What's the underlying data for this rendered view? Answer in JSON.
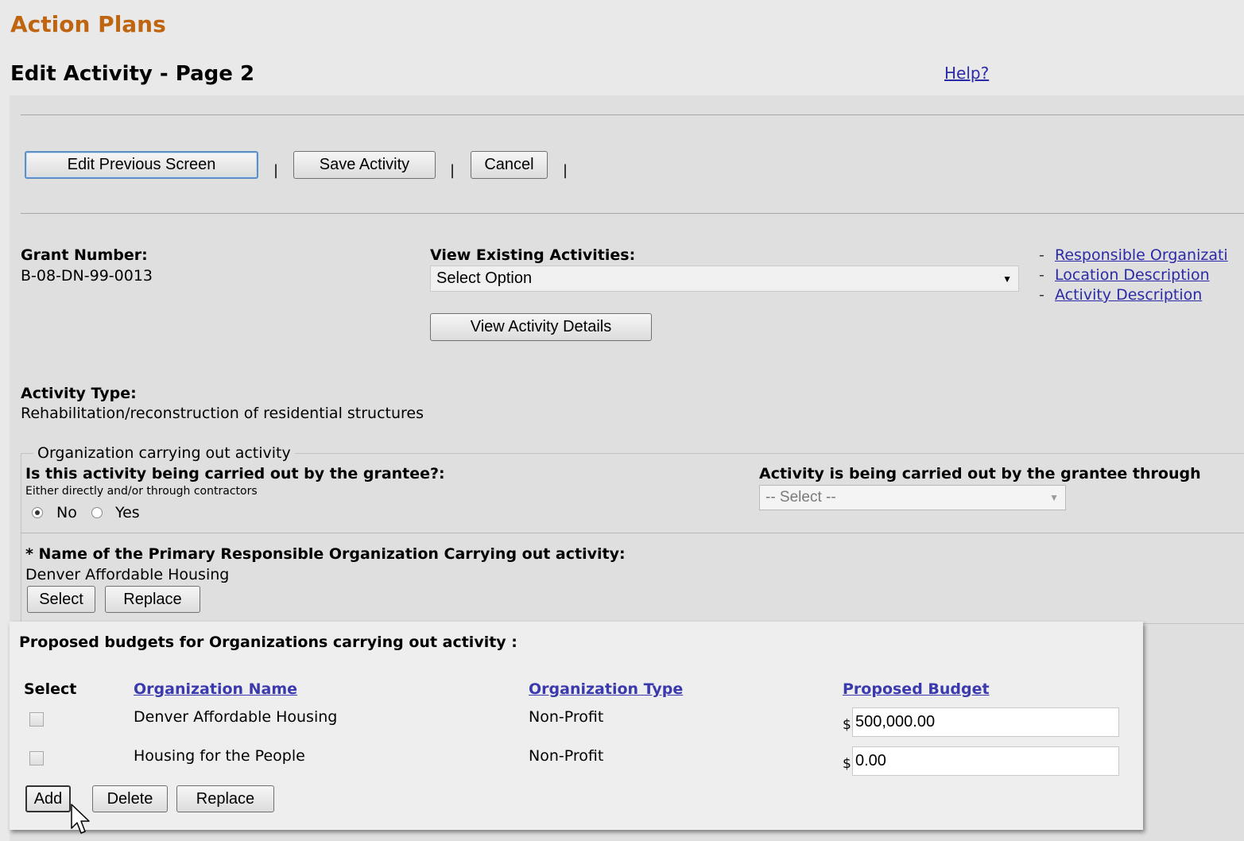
{
  "app_title": "Action Plans",
  "page_title": "Edit Activity - Page 2",
  "help_link": "Help?",
  "toolbar": {
    "edit_previous_label": "Edit Previous Screen",
    "save_label": "Save Activity",
    "cancel_label": "Cancel",
    "separator": "|"
  },
  "grant": {
    "label": "Grant Number:",
    "value": "B-08-DN-99-0013"
  },
  "view_existing": {
    "label": "View Existing Activities:",
    "selected": "Select Option",
    "details_button": "View Activity Details"
  },
  "quick_links": [
    {
      "dash": "-",
      "label": "Responsible Organizati"
    },
    {
      "dash": "-",
      "label": "Location Description"
    },
    {
      "dash": "-",
      "label": "Activity Description"
    }
  ],
  "activity_type": {
    "label": "Activity Type:",
    "value": "Rehabilitation/reconstruction of residential structures"
  },
  "org_section": {
    "legend": "Organization carrying out activity",
    "question": "Is this activity being carried out by the grantee?:",
    "hint": "Either directly and/or through contractors",
    "options": [
      {
        "label": "No",
        "checked": true
      },
      {
        "label": "Yes",
        "checked": false
      }
    ],
    "through_label": "Activity is being carried out by the grantee through",
    "through_selected": "-- Select --",
    "primary_label": "* Name of the Primary Responsible Organization Carrying out activity:",
    "primary_value": "Denver Affordable Housing",
    "select_button": "Select",
    "replace_button": "Replace"
  },
  "budgets": {
    "title": "Proposed budgets for Organizations carrying out activity :",
    "headers": {
      "select": "Select",
      "org_name": "Organization Name",
      "org_type": "Organization Type",
      "budget": "Proposed Budget"
    },
    "currency": "$",
    "rows": [
      {
        "name": "Denver Affordable Housing",
        "type": "Non-Profit",
        "budget": "500,000.00"
      },
      {
        "name": "Housing for the People",
        "type": "Non-Profit",
        "budget": "0.00"
      }
    ],
    "add_button": "Add",
    "delete_button": "Delete",
    "replace_button": "Replace"
  }
}
